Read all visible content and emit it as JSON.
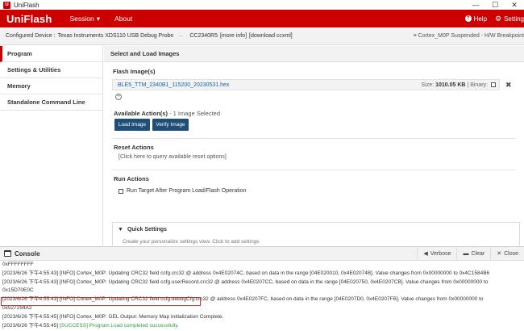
{
  "window": {
    "title": "UniFlash",
    "logo_glyph": "U",
    "minimize": "—",
    "maximize": "☐",
    "close": "✕"
  },
  "header": {
    "brand": "UniFlash",
    "session_label": "Session",
    "session_caret": "▾",
    "about_label": "About",
    "help_label": "Help",
    "help_glyph": "?",
    "settings_label": "Setting",
    "settings_glyph": "⚙",
    "accent": "#cc0000"
  },
  "device_bar": {
    "label": "Configured Device :",
    "probe": "Texas Instruments XDS110 USB Debug Probe",
    "separator": "→",
    "device": "CC2340R5",
    "more_info": "[more info]",
    "download": "[download ccxml]",
    "status": "≡ Cortex_M0P Suspended - H/W Breakpoint"
  },
  "left_nav": [
    {
      "label": "Program",
      "active": true
    },
    {
      "label": "Settings & Utilities",
      "active": false
    },
    {
      "label": "Memory",
      "active": false
    },
    {
      "label": "Standalone Command Line",
      "active": false
    }
  ],
  "main": {
    "title": "Select and Load Images",
    "flash_title": "Flash Image(s)",
    "file_name": "BLE5_TTM_2340B1_115200_20230531.hex",
    "size_label": "Size:",
    "size_value": "1010.05 KB",
    "binary_label": "| Binary:",
    "remove_glyph": "✖",
    "add_glyph": "+",
    "actions_title": "Available Action(s)",
    "actions_count": "- 1 Image Selected",
    "load_button": "Load Image",
    "verify_button": "Verify Image",
    "reset_title": "Reset Actions",
    "reset_link": "[Click here to query available reset options]",
    "run_title": "Run Actions",
    "run_option": "Run Target After Program Load/Flash Operation",
    "quick_title": "Quick Settings",
    "quick_caret": "▼",
    "quick_sub": "Create your personalize settings view. Click to add settings"
  },
  "console": {
    "title": "Console",
    "verbose_label": "Verbose",
    "verbose_glyph": "◀",
    "clear_label": "Clear",
    "clear_glyph": "▬",
    "close_label": "Close",
    "close_glyph": "✕",
    "lines": [
      {
        "text": "0xFFFFFFFF"
      },
      {
        "text": "[2023/6/26 下午4:55:43] [INFO] Cortex_M0P: Updating CRC32 field ccfg.crc32 @ address 0x4E02074C, based on data in the range [04E020010, 0x4E02074B]. Value changes from 0x00000000 to 0x4C1584B6"
      },
      {
        "text": "[2023/6/26 下午4:55:43] [INFO] Cortex_M0P: Updating CRC32 field ccfg.userRecord.crc32 @ address 0x4E0207CC, based on data in the range [04E020750, 0x4E0207CB]. Value changes from 0x00000000 to"
      },
      {
        "text": "0x15D70E0C"
      },
      {
        "text": "[2023/6/26 下午4:55:43] [INFO] Cortex_M0P: Updating CRC32 field ccfg.debugCfg.crc32 @ address 0x4E0207FC, based on data in the range [04E0207D0, 0x4E0207FB]. Value changes from 0x00000000 to"
      },
      {
        "text": "0x527294A2"
      },
      {
        "text": "[2023/6/26 下午4:55:45] [INFO] Cortex_M0P: GEL Output: Memory Map Initialization Complete."
      }
    ],
    "success_timestamp": "[2023/6/26 下午4:55:45]",
    "success_message": "[SUCCESS] Program Load completed successfully.",
    "success_color": "#2e9e3e"
  }
}
